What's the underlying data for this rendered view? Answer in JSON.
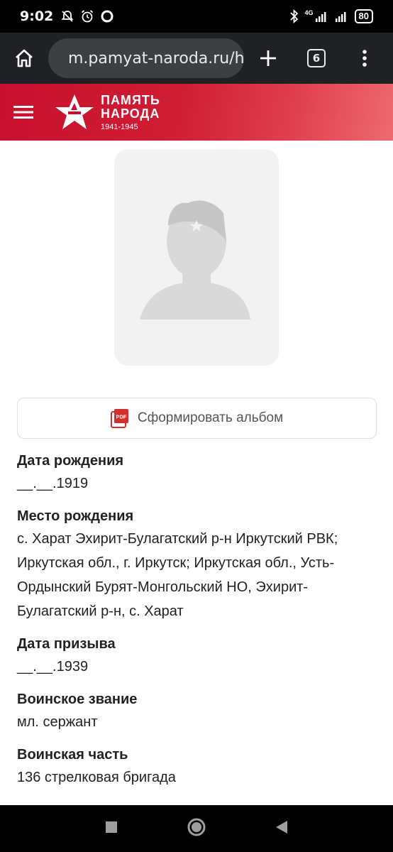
{
  "status_bar": {
    "time": "9:02",
    "network": "4G",
    "battery": "80"
  },
  "browser": {
    "url": "m.pamyat-naroda.ru/h",
    "tab_count": "6"
  },
  "site": {
    "logo_line1": "ПАМЯТЬ",
    "logo_line2": "НАРОДА",
    "logo_years": "1941-1945",
    "brand_color": "#c8102e"
  },
  "album_button": {
    "icon_text": "PDF",
    "label": "Сформировать альбом"
  },
  "fields": [
    {
      "label": "Дата рождения",
      "value": "__.__.1919"
    },
    {
      "label": "Место рождения",
      "value": "с. Харат Эхирит-Булагатский р-н Иркутский РВК; Иркутская обл., г. Иркутск; Иркутская обл., Усть-Ордынский Бурят-Монгольский НО, Эхирит-Булагатский р-н, с. Харат"
    },
    {
      "label": "Дата призыва",
      "value": "__.__.1939"
    },
    {
      "label": "Воинское звание",
      "value": "мл. сержант"
    },
    {
      "label": "Воинская часть",
      "value": "136 стрелковая бригада"
    }
  ]
}
